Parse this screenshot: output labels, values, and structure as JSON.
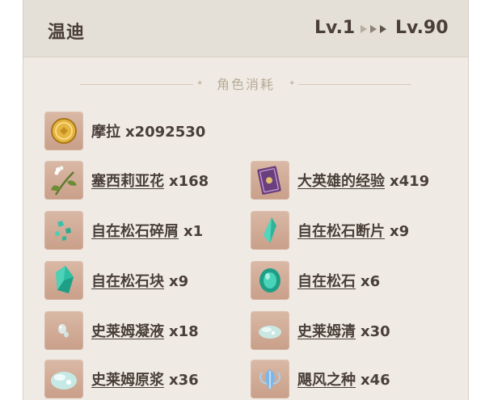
{
  "header": {
    "character": "温迪",
    "level_from": "Lv.1",
    "level_arrows": "▸▸▸",
    "level_to": "Lv.90"
  },
  "section": {
    "title": "角色消耗"
  },
  "materials": [
    {
      "name": "摩拉",
      "count": "x2092530",
      "icon": "mora-coin-icon",
      "underline": false
    },
    {
      "name": "塞西莉亚花",
      "count": "x168",
      "icon": "cecilia-flower-icon",
      "underline": true
    },
    {
      "name": "大英雄的经验",
      "count": "x419",
      "icon": "heros-wit-book-icon",
      "underline": true
    },
    {
      "name": "自在松石碎屑",
      "count": "x1",
      "icon": "turquoise-sliver-icon",
      "underline": true
    },
    {
      "name": "自在松石断片",
      "count": "x9",
      "icon": "turquoise-fragment-icon",
      "underline": true
    },
    {
      "name": "自在松石块",
      "count": "x9",
      "icon": "turquoise-chunk-icon",
      "underline": true
    },
    {
      "name": "自在松石",
      "count": "x6",
      "icon": "turquoise-gemstone-icon",
      "underline": true
    },
    {
      "name": "史莱姆凝液",
      "count": "x18",
      "icon": "slime-condensate-icon",
      "underline": true
    },
    {
      "name": "史莱姆清",
      "count": "x30",
      "icon": "slime-secretions-icon",
      "underline": true
    },
    {
      "name": "史莱姆原浆",
      "count": "x36",
      "icon": "slime-concentrate-icon",
      "underline": true
    },
    {
      "name": "飓风之种",
      "count": "x46",
      "icon": "hurricane-seed-icon",
      "underline": true
    }
  ]
}
